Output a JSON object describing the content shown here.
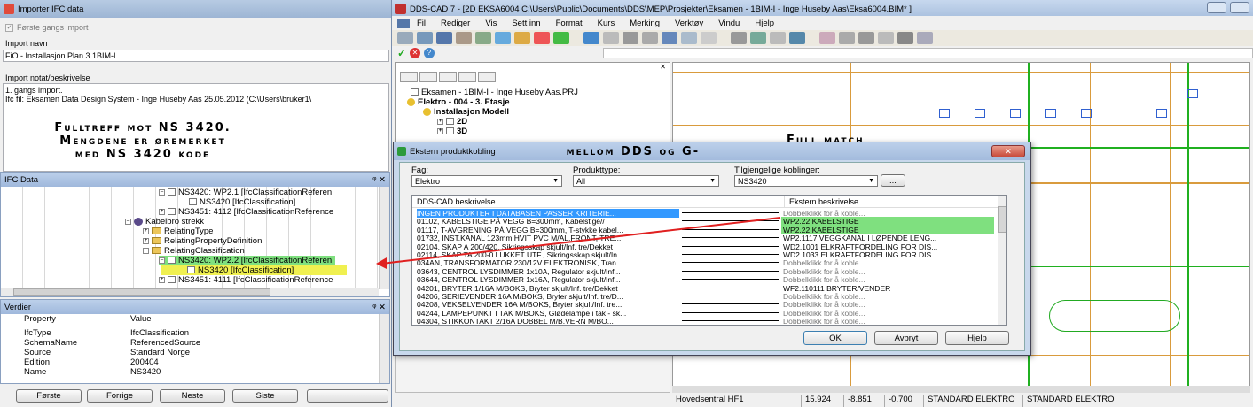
{
  "importer": {
    "title": "Importer IFC data",
    "first_import_label": "Første gangs import",
    "import_name_label": "Import navn",
    "import_name_value": "FiO - Installasjon Plan.3 1BIM-I",
    "import_note_label": "Import notat/beskrivelse",
    "import_note_line1": "1. gangs import.",
    "import_note_line2": "Ifc fil: Eksamen Data Design System - Inge Huseby Aas 25.05.2012  (C:\\Users\\bruker1\\",
    "overlay_line1": "Fulltreff mot NS 3420.",
    "overlay_line2": "Mengdene er øremerket",
    "overlay_line3": "med NS 3420 kode"
  },
  "ifc_panel": {
    "title": "IFC Data",
    "pin": "ᵠ ✕",
    "items": [
      "NS3420: WP2.1 [IfcClassificationReferen",
      "NS3420 [IfcClassification]",
      "NS3451: 4112 [IfcClassificationReference",
      "Kabelbro strekk",
      "RelatingType",
      "RelatingPropertyDefinition",
      "RelatingClassification",
      "NS3420: WP2.2 [IfcClassificationReferen",
      "NS3420 [IfcClassification]",
      "NS3451: 4111 [IfcClassificationReference"
    ]
  },
  "values_panel": {
    "title": "Verdier",
    "col_property": "Property",
    "col_value": "Value",
    "rows": [
      {
        "p": "IfcType",
        "v": "IfcClassification"
      },
      {
        "p": "SchemaName",
        "v": "ReferencedSource"
      },
      {
        "p": "Source",
        "v": "Standard Norge"
      },
      {
        "p": "Edition",
        "v": "200404"
      },
      {
        "p": "Name",
        "v": "NS3420"
      }
    ]
  },
  "nav_buttons": {
    "first": "Første",
    "prev": "Forrige",
    "next": "Neste",
    "last": "Siste"
  },
  "cad": {
    "title": "DDS-CAD 7 - [2D  EKSA6004  C:\\Users\\Public\\Documents\\DDS\\MEP\\Prosjekter\\Eksamen - 1BIM-I - Inge Huseby Aas\\Eksa6004.BIM* ]",
    "menu": [
      "Fil",
      "Rediger",
      "Vis",
      "Sett inn",
      "Format",
      "Kurs",
      "Merking",
      "Verktøy",
      "Vindu",
      "Hjelp"
    ],
    "tree": [
      "Eksamen - 1BIM-I - Inge Huseby Aas.PRJ",
      "Elektro - 004 - 3. Etasje",
      "Installasjon Modell",
      "2D",
      "3D"
    ],
    "overlay_right": "Full match",
    "status": [
      "Hovedsentral HF1",
      "15.924",
      "-8.851",
      "-0.700",
      "STANDARD ELEKTRO",
      "STANDARD ELEKTRO"
    ]
  },
  "dialog": {
    "title": "Ekstern produktkobling",
    "overlay": "mellom DDS og G-",
    "fag_label": "Fag:",
    "fag_value": "Elektro",
    "produkttype_label": "Produkttype:",
    "produkttype_value": "All",
    "koblinger_label": "Tilgjengelige koblinger:",
    "koblinger_value": "NS3420",
    "more_button": "...",
    "col_dds": "DDS-CAD beskrivelse",
    "col_ext": "Ekstern beskrivelse",
    "rows": [
      {
        "dds": "INGEN PRODUKTER I DATABASEN PASSER KRITERIE...",
        "ext": "Dobbelklikk for å koble...",
        "hl": "sel"
      },
      {
        "dds": "01102, KABELSTIGE PÅ VEGG B=300mm, Kabelstige//",
        "ext": "WP2.22 KABELSTIGE",
        "hl": "green"
      },
      {
        "dds": "01117, T-AVGRENING PÅ VEGG B=300mm, T-stykke kabel...",
        "ext": "WP2.22 KABELSTIGE",
        "hl": "green"
      },
      {
        "dds": "01732, INST.KANAL 123mm HVIT PVC M/AL.FRONT, TRE...",
        "ext": "WP2.1117 VEGGKANAL I LØPENDE LENG...",
        "hl": ""
      },
      {
        "dds": "02104, SKAP A 200/420, Sikringsskap skjult/Inf. tre/Dekket",
        "ext": "WD2.1001 ELKRAFTFORDELING FOR DIS...",
        "hl": ""
      },
      {
        "dds": "02114, SKAP TA 200-0 LUKKET UTF., Sikringsskap skjult/In...",
        "ext": "WD2.1033 ELKRAFTFORDELING FOR DIS...",
        "hl": ""
      },
      {
        "dds": "034AN, TRANSFORMATOR 230/12V ELEKTRONISK, Tran...",
        "ext": "Dobbelklikk for å koble...",
        "hl": ""
      },
      {
        "dds": "03643, CENTROL LYSDIMMER 1x10A, Regulator skjult/Inf...",
        "ext": "Dobbelklikk for å koble...",
        "hl": ""
      },
      {
        "dds": "03644, CENTROL LYSDIMMER 1x16A, Regulator skjult/Inf...",
        "ext": "Dobbelklikk for å koble...",
        "hl": ""
      },
      {
        "dds": "04201, BRYTER 1/16A M/BOKS, Bryter skjult/Inf. tre/Dekket",
        "ext": "WF2.110111 BRYTER/VENDER",
        "hl": ""
      },
      {
        "dds": "04206, SERIEVENDER 16A M/BOKS, Bryter skjult/Inf. tre/D...",
        "ext": "Dobbelklikk for å koble...",
        "hl": ""
      },
      {
        "dds": "04208, VEKSELVENDER  16A M/BOKS, Bryter skjult/Inf. tre...",
        "ext": "Dobbelklikk for å koble...",
        "hl": ""
      },
      {
        "dds": "04244, LAMPEPUNKT I TAK M/BOKS, Glødelampe i tak - sk...",
        "ext": "Dobbelklikk for å koble...",
        "hl": ""
      },
      {
        "dds": "04304, STIKKONTAKT 2/16A  DOBBEL M/B.VERN M/BO...",
        "ext": "Dobbelklikk for å koble...",
        "hl": ""
      }
    ],
    "ok": "OK",
    "cancel": "Avbryt",
    "help": "Hjelp"
  }
}
